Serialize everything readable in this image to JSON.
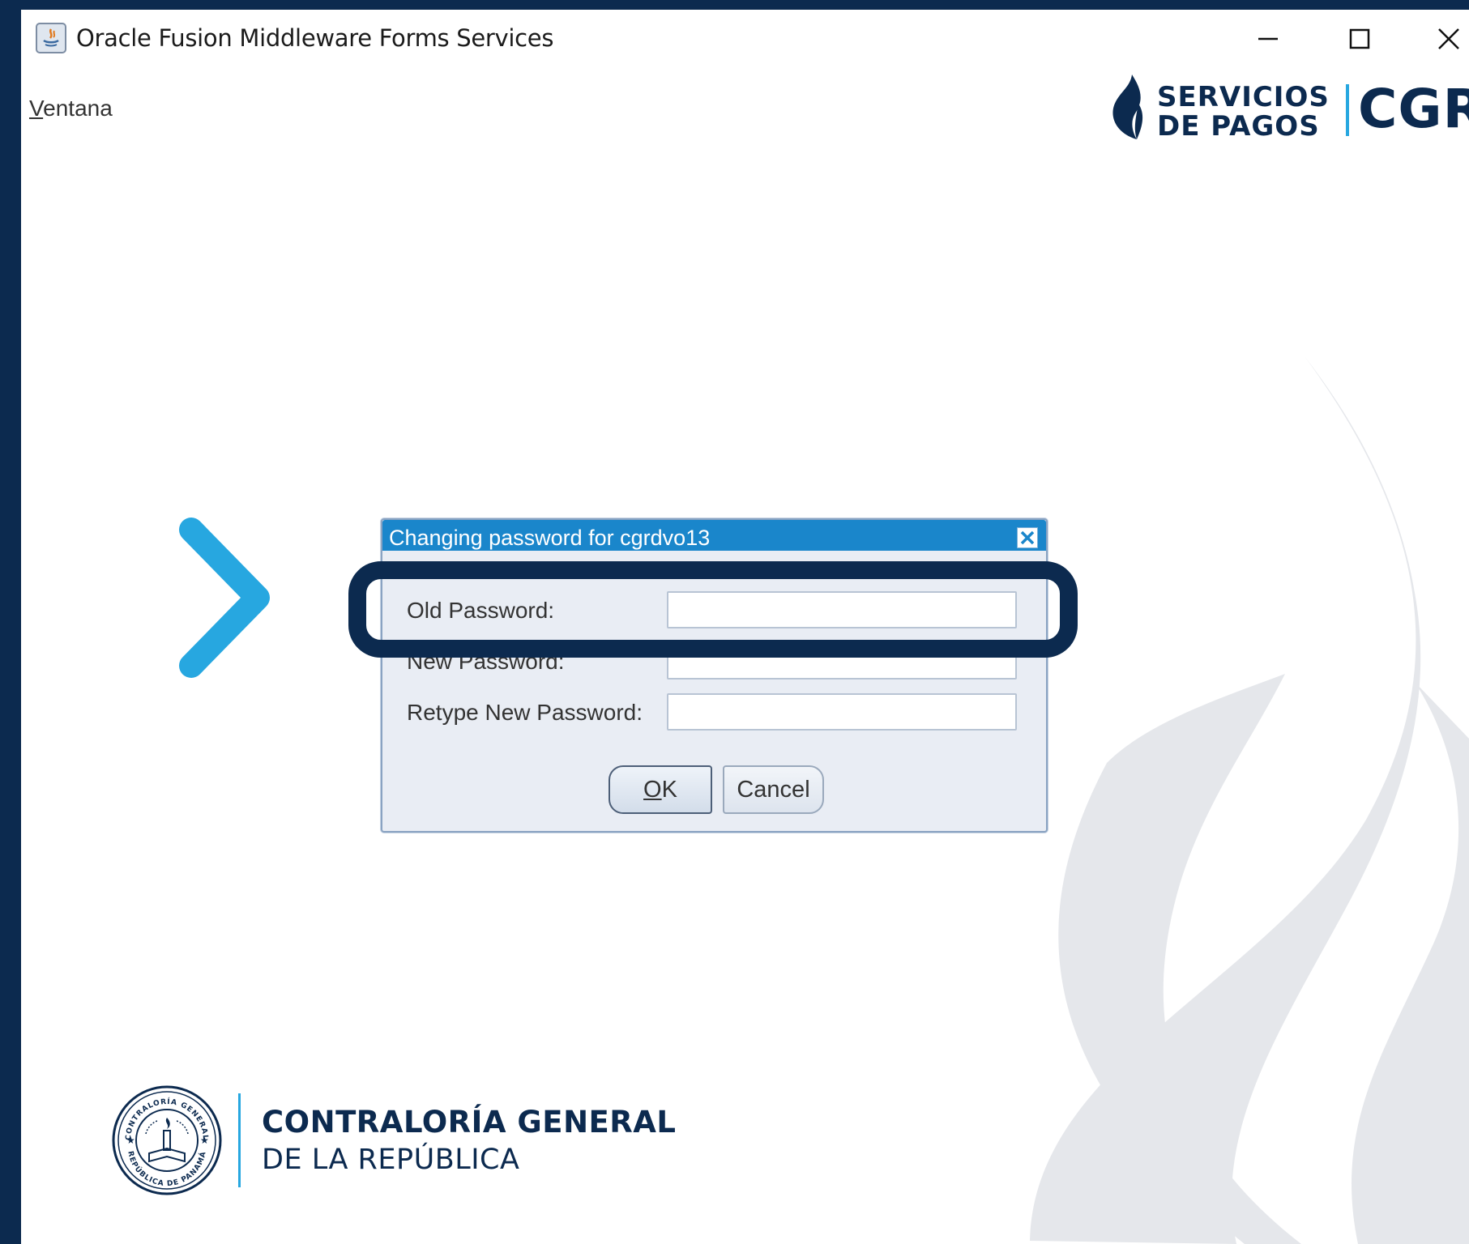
{
  "window": {
    "title": "Oracle Fusion Middleware Forms Services",
    "controls": {
      "minimize_icon": "minimize-icon",
      "maximize_icon": "maximize-icon",
      "close_icon": "close-icon"
    }
  },
  "menu": {
    "ventana_mnemonic": "V",
    "ventana_rest": "entana"
  },
  "brand": {
    "line1": "SERVICIOS",
    "line2": "DE PAGOS",
    "acronym": "CGR",
    "logo_icon": "flame-icon"
  },
  "dialog": {
    "title": "Changing password for cgrdvo13",
    "fields": [
      {
        "label": "Old Password:",
        "value": ""
      },
      {
        "label": "New Password:",
        "value": ""
      },
      {
        "label": "Retype New Password:",
        "value": ""
      }
    ],
    "ok_mnemonic": "O",
    "ok_rest": "K",
    "cancel_label": "Cancel"
  },
  "footer": {
    "org_line1": "CONTRALORÍA GENERAL",
    "org_line2": "DE LA REPÚBLICA",
    "seal_text_top": "CONTRALORÍA GENERAL",
    "seal_text_bottom": "REPÚBLICA DE PANAMÁ"
  },
  "colors": {
    "navy": "#0c2a4f",
    "accent_blue": "#27a7e0",
    "dialog_title_bg": "#1a86cb",
    "watermark": "#e5e7eb"
  }
}
